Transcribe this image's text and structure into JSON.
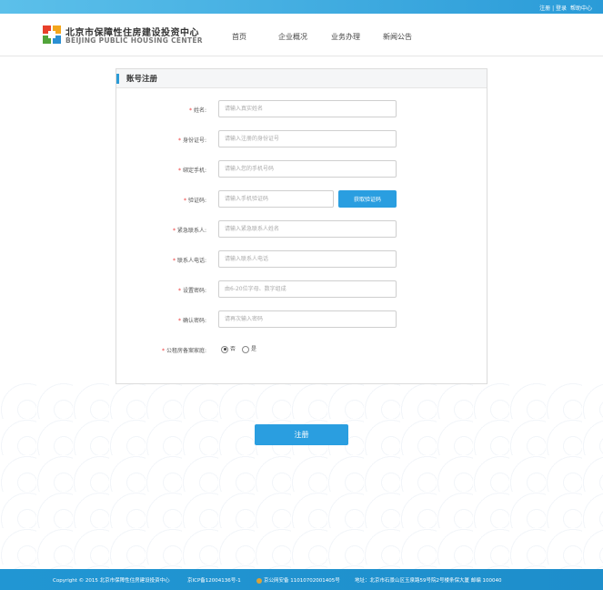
{
  "topbar": {
    "register_login": "注册 | 登录",
    "help": "帮助中心"
  },
  "header": {
    "logo_cn": "北京市保障性住房建设投资中心",
    "logo_en": "BEIJING PUBLIC HOUSING CENTER",
    "nav": [
      "首页",
      "企业概况",
      "业务办理",
      "新闻公告"
    ]
  },
  "form": {
    "title": "账号注册",
    "fields": [
      {
        "label": "姓名:",
        "placeholder": "请输入真实姓名"
      },
      {
        "label": "身份证号:",
        "placeholder": "请输入注册的身份证号"
      },
      {
        "label": "绑定手机:",
        "placeholder": "请输入您的手机号码"
      },
      {
        "label": "验证码:",
        "placeholder": "请输入手机验证码"
      },
      {
        "label": "紧急联系人:",
        "placeholder": "请输入紧急联系人姓名"
      },
      {
        "label": "联系人电话:",
        "placeholder": "请输入联系人电话"
      },
      {
        "label": "设置密码:",
        "placeholder": "由6-20位字母、数字组成"
      },
      {
        "label": "确认密码:",
        "placeholder": "请再次输入密码"
      }
    ],
    "required_mark": "*",
    "get_code_button": "获取验证码",
    "family_question": "公租房备案家庭:",
    "radio_options": [
      "否",
      "是"
    ],
    "radio_selected": "否",
    "submit": "注册"
  },
  "footer": {
    "copyright": "Copyright © 2015 北京市保障性住房建设投资中心",
    "icp": "京ICP备12004136号-1",
    "police": "京公网安备 11010702001405号",
    "address": "地址：北京市石景山区玉泉路59号院2号楼条保大厦 邮编 100040"
  },
  "colors": {
    "accent": "#2a9ee0",
    "required": "#e33333"
  }
}
